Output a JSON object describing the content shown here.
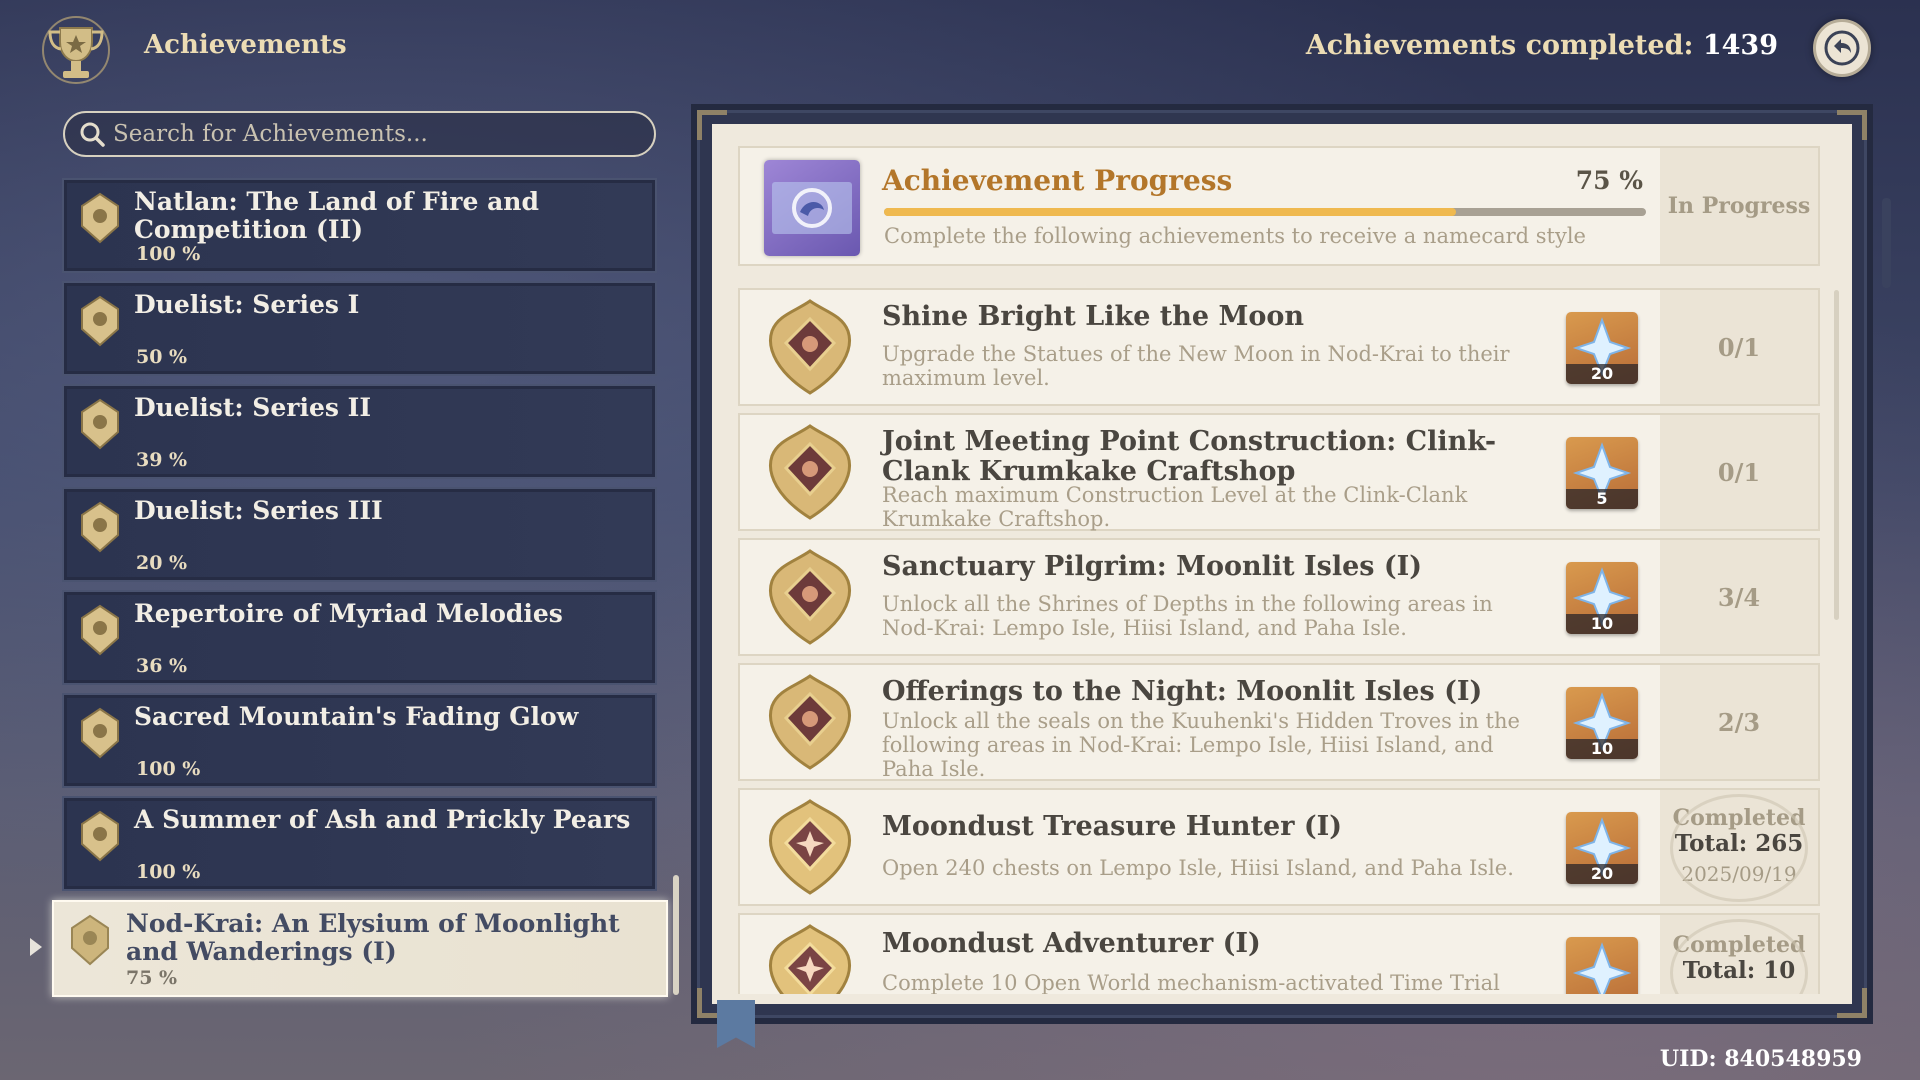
{
  "header": {
    "title": "Achievements",
    "completed_label": "Achievements completed:",
    "completed_value": "1439",
    "back_icon": "back-arrow-icon"
  },
  "search": {
    "placeholder": "Search for Achievements...",
    "value": ""
  },
  "categories": [
    {
      "title": "Natlan: The Land of Fire and Competition (II)",
      "percent": "100 %"
    },
    {
      "title": "Duelist: Series I",
      "percent": "50 %"
    },
    {
      "title": "Duelist: Series II",
      "percent": "39 %"
    },
    {
      "title": "Duelist: Series III",
      "percent": "20 %"
    },
    {
      "title": "Repertoire of Myriad Melodies",
      "percent": "36 %"
    },
    {
      "title": "Sacred Mountain's Fading Glow",
      "percent": "100 %"
    },
    {
      "title": "A Summer of Ash and Prickly Pears",
      "percent": "100 %"
    },
    {
      "title": "Nod-Krai: An Elysium of Moonlight and Wanderings (I)",
      "percent": "75 %",
      "selected": true
    }
  ],
  "progress": {
    "title": "Achievement Progress",
    "percent_label": "75 %",
    "percent_value": 75,
    "description": "Complete the following achievements to receive a namecard style",
    "status": "In Progress"
  },
  "achievements": [
    {
      "title": "Shine Bright Like the Moon",
      "description": "Upgrade the Statues of the New Moon in Nod-Krai to their maximum level.",
      "reward": "20",
      "status": "0/1"
    },
    {
      "title": "Joint Meeting Point Construction: Clink-Clank Krumkake Craftshop",
      "description": "Reach maximum Construction Level at the Clink-Clank Krumkake Craftshop.",
      "reward": "5",
      "status": "0/1"
    },
    {
      "title": "Sanctuary Pilgrim: Moonlit Isles (I)",
      "description": "Unlock all the Shrines of Depths in the following areas in Nod-Krai: Lempo Isle, Hiisi Island, and Paha Isle.",
      "reward": "10",
      "status": "3/4"
    },
    {
      "title": "Offerings to the Night: Moonlit Isles (I)",
      "description": "Unlock all the seals on the Kuuhenki's Hidden Troves in the following areas in Nod-Krai: Lempo Isle, Hiisi Island, and Paha Isle.",
      "reward": "10",
      "status": "2/3"
    },
    {
      "title": "Moondust Treasure Hunter (I)",
      "description": "Open 240 chests on Lempo Isle, Hiisi Island, and Paha Isle.",
      "reward": "20",
      "completed_label": "Completed",
      "total": "Total: 265",
      "date": "2025/09/19"
    },
    {
      "title": "Moondust Adventurer (I)",
      "description": "Complete 10 Open World mechanism-activated Time Trial",
      "reward": "",
      "completed_label": "Completed",
      "total": "Total: 10"
    }
  ],
  "footer": {
    "uid": "UID: 840548959"
  },
  "colors": {
    "accent_gold": "#b3762a",
    "progress_fill": "#efb94f",
    "panel_bg": "#efe9dd",
    "list_bg": "#2c3450"
  }
}
